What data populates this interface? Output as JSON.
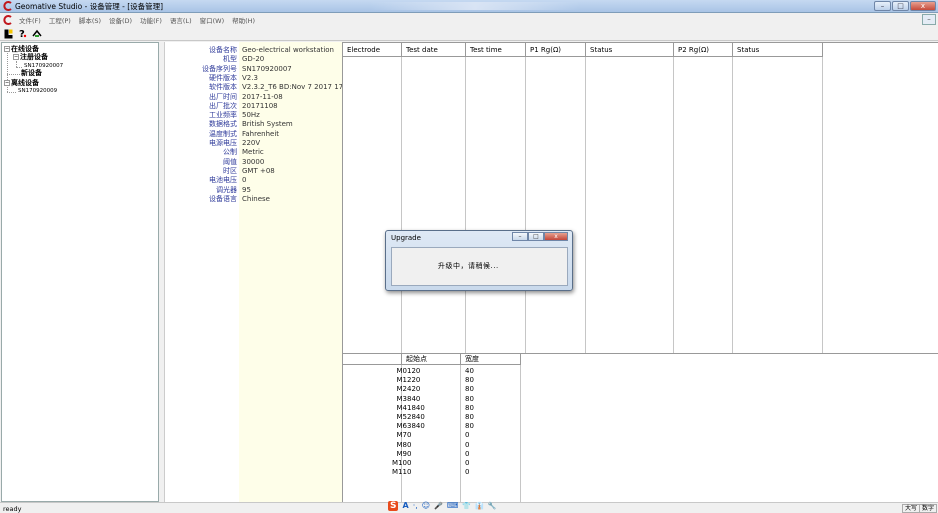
{
  "window": {
    "title": "Geomative Studio - 设备管理 - [设备管理]",
    "minimize": "–",
    "maximize": "□",
    "close": "x"
  },
  "menu": {
    "items": [
      "文件(F)",
      "工程(P)",
      "脚本(S)",
      "设备(D)",
      "功能(F)",
      "语言(L)",
      "窗口(W)",
      "帮助(H)"
    ],
    "restore": "–"
  },
  "tree": {
    "online": "在线设备",
    "registered": "注册设备",
    "registered_child": "SN170920007",
    "new": "新设备",
    "offline": "离线设备",
    "offline_child": "SN170920009",
    "expander_open": "−"
  },
  "properties": [
    {
      "key": "设备名称",
      "value": "Geo-electrical workstation"
    },
    {
      "key": "机型",
      "value": "GD-20"
    },
    {
      "key": "设备序列号",
      "value": "SN170920007"
    },
    {
      "key": "硬件版本",
      "value": "V2.3"
    },
    {
      "key": "软件版本",
      "value": "V2.3.2_T6 BD:Nov  7 2017 17"
    },
    {
      "key": "出厂时间",
      "value": "2017-11-08"
    },
    {
      "key": "出厂批次",
      "value": "20171108"
    },
    {
      "key": "工业频率",
      "value": "50Hz"
    },
    {
      "key": "数据格式",
      "value": "British System"
    },
    {
      "key": "温度制式",
      "value": "Fahrenheit"
    },
    {
      "key": "电源电压",
      "value": "220V"
    },
    {
      "key": "公制",
      "value": "Metric"
    },
    {
      "key": "阈值",
      "value": "30000"
    },
    {
      "key": "时区",
      "value": "GMT +08"
    },
    {
      "key": "电池电压",
      "value": "0"
    },
    {
      "key": "调光器",
      "value": "95"
    },
    {
      "key": "设备语言",
      "value": "Chinese"
    }
  ],
  "grid": {
    "columns": [
      "Electrode",
      "Test date",
      "Test time",
      "P1 Rg(Ω)",
      "Status",
      "P2 Rg(Ω)",
      "Status"
    ]
  },
  "lower": {
    "columns": [
      "起始点",
      "宽度"
    ],
    "rows": [
      {
        "label": "M0",
        "start": "120",
        "width": "40"
      },
      {
        "label": "M1",
        "start": "220",
        "width": "80"
      },
      {
        "label": "M2",
        "start": "420",
        "width": "80"
      },
      {
        "label": "M3",
        "start": "840",
        "width": "80"
      },
      {
        "label": "M4",
        "start": "1840",
        "width": "80"
      },
      {
        "label": "M5",
        "start": "2840",
        "width": "80"
      },
      {
        "label": "M6",
        "start": "3840",
        "width": "80"
      },
      {
        "label": "M7",
        "start": "0",
        "width": "0"
      },
      {
        "label": "M8",
        "start": "0",
        "width": "0"
      },
      {
        "label": "M9",
        "start": "0",
        "width": "0"
      },
      {
        "label": "M10",
        "start": "0",
        "width": "0"
      },
      {
        "label": "M11",
        "start": "0",
        "width": "0"
      }
    ]
  },
  "dialog": {
    "title": "Upgrade",
    "message": "升级中，请稍候...",
    "minimize": "–",
    "maximize": "□",
    "close": "x"
  },
  "status": {
    "text": "ready",
    "caps": "大写",
    "num": "数字"
  },
  "ime": {
    "logo": "S",
    "mode": "A",
    "icons": [
      "·,",
      "☺",
      "🎤",
      "⌨",
      "👕",
      "👔",
      "🔧"
    ]
  },
  "colors": {
    "prop_key": "#2e3a9a",
    "prop_value_bg": "#fefee9",
    "brand_red": "#c0161c"
  }
}
